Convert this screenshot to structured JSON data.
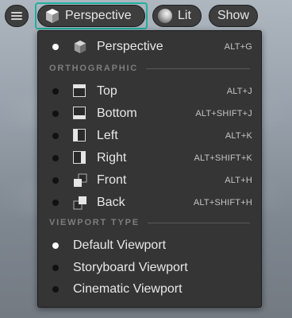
{
  "toolbar": {
    "menu_icon": "hamburger-menu-icon",
    "perspective_label": "Perspective",
    "perspective_icon": "cube-icon",
    "lit_label": "Lit",
    "lit_icon": "lit-sphere-icon",
    "show_label": "Show",
    "accent_color": "#1fb0a0"
  },
  "menu": {
    "perspective": {
      "label": "Perspective",
      "shortcut": "ALT+G",
      "icon": "cube-icon",
      "selected": true
    },
    "orthographic_header": "ORTHOGRAPHIC",
    "orthographic": [
      {
        "label": "Top",
        "shortcut": "ALT+J",
        "icon": "view-top-icon",
        "selected": false
      },
      {
        "label": "Bottom",
        "shortcut": "ALT+SHIFT+J",
        "icon": "view-bottom-icon",
        "selected": false
      },
      {
        "label": "Left",
        "shortcut": "ALT+K",
        "icon": "view-left-icon",
        "selected": false
      },
      {
        "label": "Right",
        "shortcut": "ALT+SHIFT+K",
        "icon": "view-right-icon",
        "selected": false
      },
      {
        "label": "Front",
        "shortcut": "ALT+H",
        "icon": "view-front-icon",
        "selected": false
      },
      {
        "label": "Back",
        "shortcut": "ALT+SHIFT+H",
        "icon": "view-back-icon",
        "selected": false
      }
    ],
    "viewport_type_header": "VIEWPORT TYPE",
    "viewport_types": [
      {
        "label": "Default Viewport",
        "selected": true
      },
      {
        "label": "Storyboard Viewport",
        "selected": false
      },
      {
        "label": "Cinematic Viewport",
        "selected": false
      }
    ]
  }
}
